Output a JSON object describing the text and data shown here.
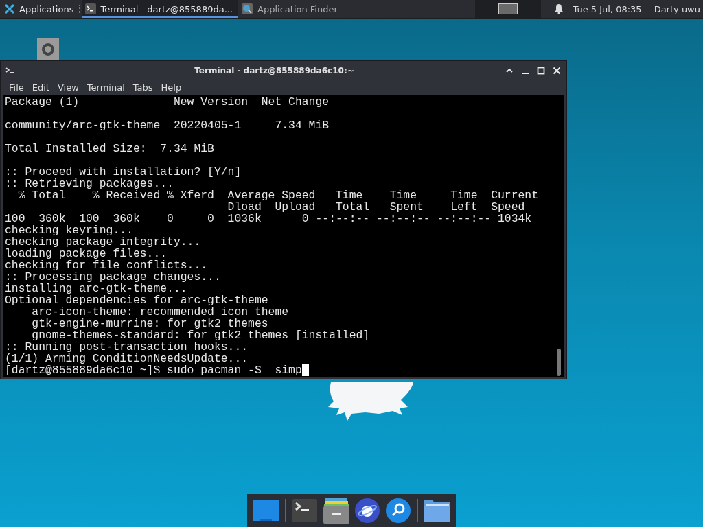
{
  "panel": {
    "menu_label": "Applications",
    "tasks": [
      {
        "title": "Terminal - dartz@855889da...",
        "kind": "terminal",
        "selected": true
      },
      {
        "title": "Application Finder",
        "kind": "finder",
        "selected": false
      }
    ],
    "clock": "Tue  5 Jul, 08:35",
    "user": "Darty uwu"
  },
  "window": {
    "title": "Terminal - dartz@855889da6c10:~",
    "menu": [
      "File",
      "Edit",
      "View",
      "Terminal",
      "Tabs",
      "Help"
    ]
  },
  "terminal": {
    "blocks": [
      [
        "Package (1)              New Version  Net Change"
      ],
      [
        "community/arc-gtk-theme  20220405-1     7.34 MiB"
      ],
      [
        "Total Installed Size:  7.34 MiB"
      ],
      [
        ":: Proceed with installation? [Y/n]",
        ":: Retrieving packages...",
        "  % Total    % Received % Xferd  Average Speed   Time    Time     Time  Current",
        "                                 Dload  Upload   Total   Spent    Left  Speed",
        "100  360k  100  360k    0     0  1036k      0 --:--:-- --:--:-- --:--:-- 1034k",
        "checking keyring...",
        "checking package integrity...",
        "loading package files...",
        "checking for file conflicts...",
        ":: Processing package changes...",
        "installing arc-gtk-theme...",
        "Optional dependencies for arc-gtk-theme",
        "    arc-icon-theme: recommended icon theme",
        "    gtk-engine-murrine: for gtk2 themes",
        "    gnome-themes-standard: for gtk2 themes [installed]",
        ":: Running post-transaction hooks...",
        "(1/1) Arming ConditionNeedsUpdate..."
      ]
    ],
    "prompt": "[dartz@855889da6c10 ~]$ sudo pacman -S  simp"
  },
  "dock": [
    {
      "kind": "desktop"
    },
    {
      "kind": "separator"
    },
    {
      "kind": "terminal"
    },
    {
      "kind": "files"
    },
    {
      "kind": "browser"
    },
    {
      "kind": "search"
    },
    {
      "kind": "separator"
    },
    {
      "kind": "folder"
    }
  ]
}
